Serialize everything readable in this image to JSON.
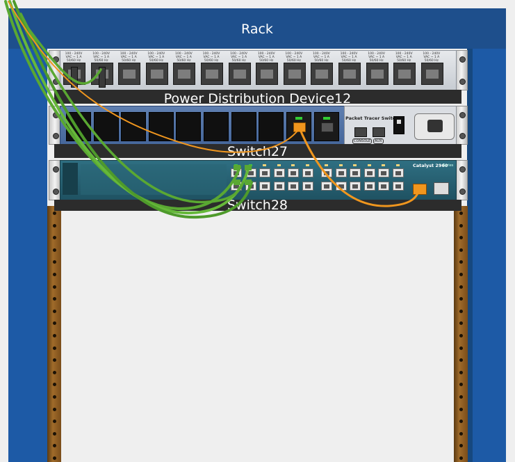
{
  "rack": {
    "title": "Rack"
  },
  "devices": {
    "pdu": {
      "label": "Power Distribution Device12",
      "outlet_caption": "100 - 240V VAC ~ 1 A 50/60 Hz",
      "outlet_count": 14
    },
    "switch27": {
      "label": "Switch27",
      "model_text": "Packet Tracer Switch",
      "console_label": "CONSOLE",
      "aux_label": "AUX"
    },
    "switch28": {
      "label": "Switch28",
      "model_text": "Catalyst 2960",
      "series_text": "Series"
    }
  },
  "colors": {
    "rack_post": "#1d5aa6",
    "rack_header": "#1e4f8c",
    "cable_green": "#5aa832",
    "cable_orange": "#f0961e"
  }
}
